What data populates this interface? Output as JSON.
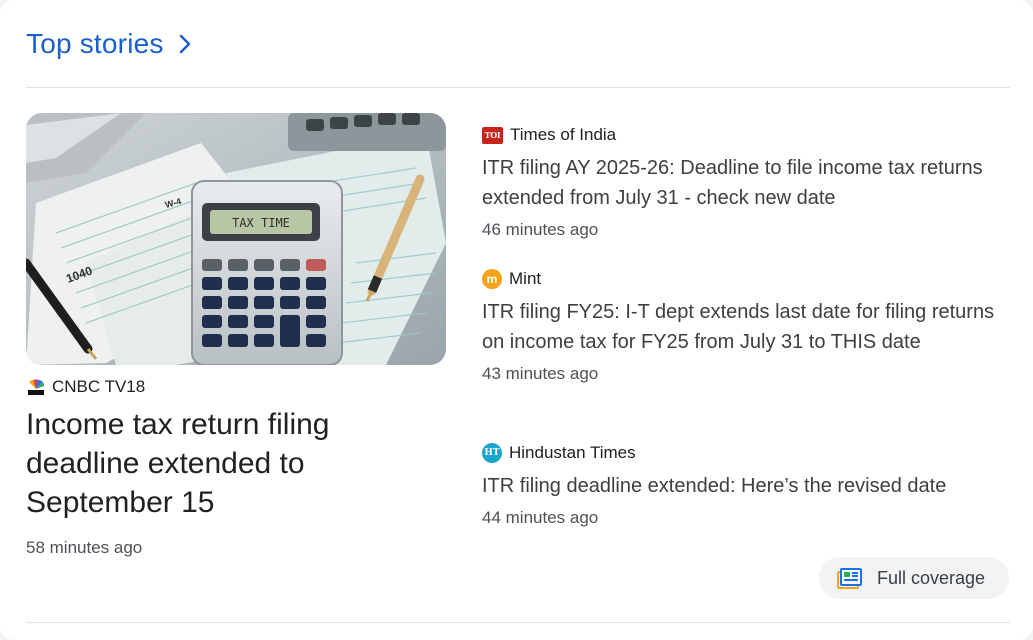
{
  "header": {
    "title": "Top stories"
  },
  "lead": {
    "source": "CNBC TV18",
    "headline": "Income tax return filing deadline extended to September 15",
    "time": "58 minutes ago",
    "image": {
      "calculator_display": "TAX TIME",
      "form_label": "1040",
      "form_label_2": "W-4"
    }
  },
  "stories": [
    {
      "source": "Times of India",
      "logo_text": "TOI",
      "headline": "ITR filing AY 2025-26: Deadline to file income tax returns extended from July 31 - check new date",
      "time": "46 minutes ago"
    },
    {
      "source": "Mint",
      "logo_text": "m",
      "headline": "ITR filing FY25: I-T dept extends last date for filing returns on income tax for FY25 from July 31 to THIS date",
      "time": "43 minutes ago"
    },
    {
      "source": "Hindustan Times",
      "logo_text": "HT",
      "headline": "ITR filing deadline extended: Here’s the revised date",
      "time": "44 minutes ago"
    }
  ],
  "full_coverage": {
    "label": "Full coverage"
  },
  "colors": {
    "link_blue": "#1a5fcc",
    "toi_red": "#c8221a",
    "mint_orange": "#f6a21a",
    "ht_teal": "#1aa6c8"
  }
}
